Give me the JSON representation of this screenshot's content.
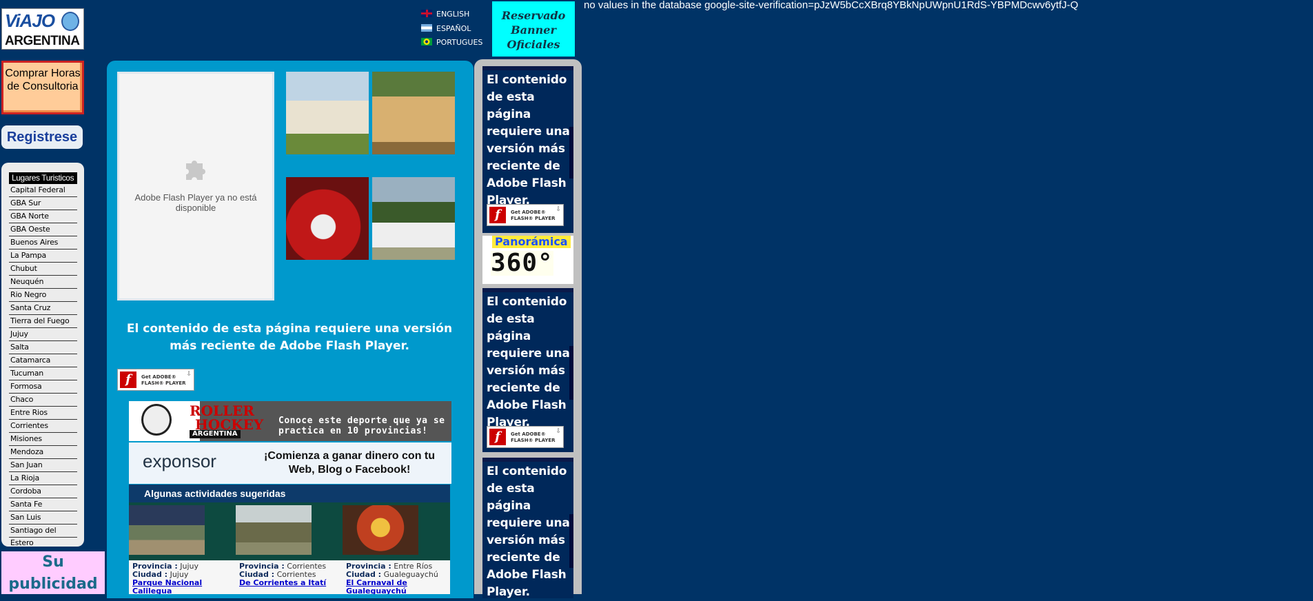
{
  "header": {
    "logo_top": "ViAJO",
    "logo_bottom": "ARGENTINA",
    "languages": [
      "ENGLISH",
      "ESPAÑOL",
      "PORTUGUES"
    ],
    "banner": "Reservado Banner Oficiales",
    "verification": "no values in the database google-site-verification=pJzW5bCcXBrq8YBkNpUWpnU1RdS-YBPMDcwv6ytfJ-Q"
  },
  "sidebar": {
    "buy_hours": "Comprar Horas de Consultoria",
    "register": "Registrese",
    "places_title": "Lugares Turisticos",
    "places": [
      "Capital Federal",
      "GBA Sur",
      "GBA Norte",
      "GBA Oeste",
      "Buenos Aires",
      "La Pampa",
      "Chubut",
      "Neuquén",
      "Rio Negro",
      "Santa Cruz",
      "Tierra del Fuego",
      "Jujuy",
      "Salta",
      "Catamarca",
      "Tucuman",
      "Formosa",
      "Chaco",
      "Entre Rios",
      "Corrientes",
      "Misiones",
      "Mendoza",
      "San Juan",
      "La Rioja",
      "Cordoba",
      "Santa Fe",
      "San Luis",
      "Santiago del Estero"
    ],
    "ad": "Su publicidad puede estar"
  },
  "center": {
    "flash_placeholder": "Adobe Flash Player ya no está disponible",
    "flash_message": "El contenido de esta página requiere una versión más reciente de Adobe Flash Player.",
    "get_flash_1": "Get ADOBE®",
    "get_flash_2": "FLASH® PLAYER",
    "hockey_logo": [
      "ROLLER",
      "HOCKEY",
      "ARGENTINA"
    ],
    "hockey_text": "Conoce este deporte que ya se practica en 10 provincias!",
    "exponsor_brand": "exponsor",
    "exponsor_tag": "¡Comienza a ganar dinero con tu Web, Blog o Facebook!",
    "activities_title": "Algunas actividades sugeridas",
    "prov_label": "Provincia :",
    "city_label": "Ciudad :",
    "activities": [
      {
        "provincia": "Jujuy",
        "ciudad": "Jujuy",
        "link": "Parque Nacional Calilegua"
      },
      {
        "provincia": "Corrientes",
        "ciudad": "Corrientes",
        "link": "De Corrientes a Itatí"
      },
      {
        "provincia": "Entre Ríos",
        "ciudad": "Gualeguaychú",
        "link": "El Carnaval de Gualeguaychú"
      }
    ]
  },
  "right": {
    "flash_message": "El contenido de esta página requiere una versión más reciente de Adobe Flash Player.",
    "pano_top": "Panorámica",
    "pano_bottom": "360°"
  },
  "colors": {
    "page_bg": "#003366",
    "center_panel": "#0099cc",
    "banner": "#00ffff"
  }
}
